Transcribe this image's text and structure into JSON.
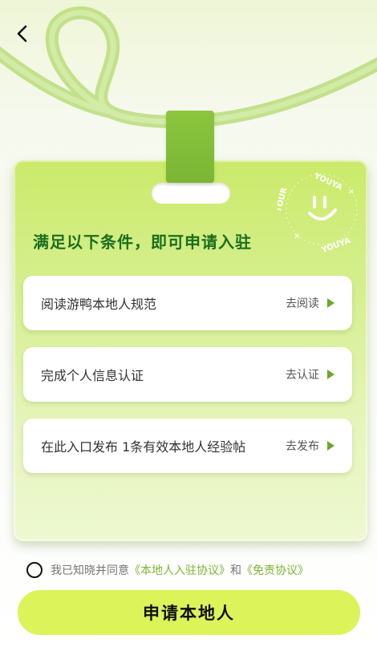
{
  "header": {
    "back_icon": "chevron-left-icon"
  },
  "card": {
    "title": "满足以下条件，即可申请入驻",
    "stamp_text_top": "YOUYA",
    "stamp_text_side": "TOUR",
    "stamp_text_bottom": "YOUYA",
    "conditions": [
      {
        "label": "阅读游鸭本地人规范",
        "action": "去阅读",
        "icon": "play-icon"
      },
      {
        "label": "完成个人信息认证",
        "action": "去认证",
        "icon": "play-icon"
      },
      {
        "label": "在此入口发布 1条有效本地人经验帖",
        "action": "去发布",
        "icon": "play-icon"
      }
    ]
  },
  "agreement": {
    "prefix": "我已知晓并同意",
    "link1": "《本地人入驻协议》",
    "middle": "和",
    "link2": "《免责协议》",
    "checked": false
  },
  "submit": {
    "label": "申请本地人"
  },
  "colors": {
    "accent_green": "#7ab534",
    "title_green": "#1b6e1e",
    "button_yellow": "#dcf35a"
  }
}
